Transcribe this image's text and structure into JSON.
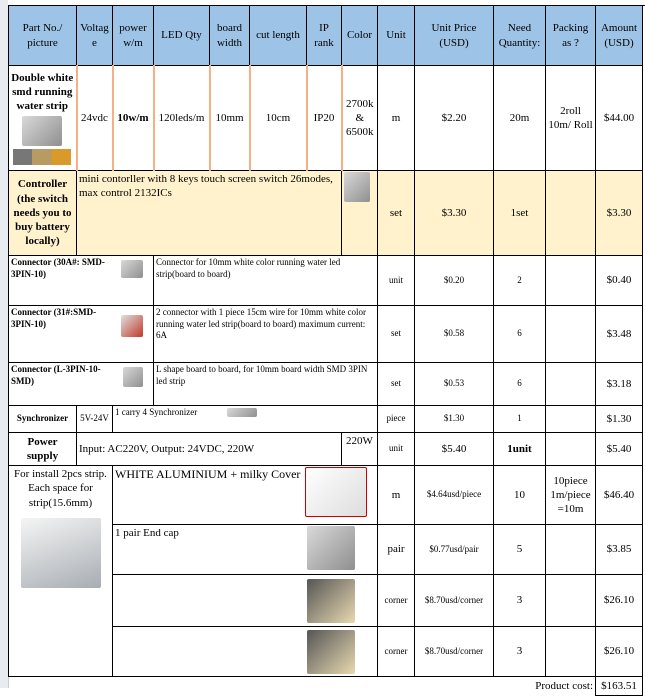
{
  "header": [
    "Part No./ picture",
    "Voltag e",
    "power w/m",
    "LED Qty",
    "board width",
    "cut length",
    "IP rank",
    "Color",
    "Unit",
    "Unit Price (USD)",
    "Need Quantity:",
    "Packing as ?",
    "Amount (USD)"
  ],
  "strip": {
    "name": "Double white smd running water strip",
    "voltage": "24vdc",
    "power": "10w/m",
    "led_qty": "120leds/m",
    "board_width": "10mm",
    "cut_length": "10cm",
    "ip": "IP20",
    "color": "2700k & 6500k",
    "unit": "m",
    "price": "$2.20",
    "qty": "20m",
    "packing": "2roll 10m/ Roll",
    "amount": "$44.00"
  },
  "controller": {
    "name": "Controller (the switch needs you to buy battery locally)",
    "desc": "mini contorller with 8 keys touch screen switch 26modes, max control 2132ICs",
    "unit": "set",
    "price": "$3.30",
    "qty": "1set",
    "amount": "$3.30"
  },
  "connectors": [
    {
      "name": "Connector (30A#: SMD-3PIN-10)",
      "desc": "Connector for 10mm white color running water led strip(board to board)",
      "unit": "unit",
      "price": "$0.20",
      "qty": "2",
      "amount": "$0.40"
    },
    {
      "name": "Connector (31#:SMD-3PIN-10)",
      "desc": "2 connector with 1 piece 15cm wire for 10mm white color running water led strip(board to board) maximum current: 6A",
      "unit": "set",
      "price": "$0.58",
      "qty": "6",
      "amount": "$3.48"
    },
    {
      "name": "Connector (L-3PIN-10-SMD)",
      "desc": "L shape board to board, for 10mm board width SMD 3PIN led strip",
      "unit": "set",
      "price": "$0.53",
      "qty": "6",
      "amount": "$3.18"
    }
  ],
  "sync": {
    "name": "Synchronizer",
    "voltage": "5V-24V",
    "desc": "1 carry 4 Synchronizer",
    "unit": "piece",
    "price": "$1.30",
    "qty": "1",
    "amount": "$1.30"
  },
  "power": {
    "name": "Power supply",
    "desc": "Input: AC220V, Output: 24VDC, 220W",
    "watt": "220W",
    "unit": "unit",
    "price": "$5.40",
    "qty": "1unit",
    "amount": "$5.40"
  },
  "alu": {
    "name": "For install 2pcs strip. Each space for strip(15.6mm)",
    "desc": "WHITE ALUMINIUM + milky Cover",
    "unit": "m",
    "price": "$4.64usd/piece",
    "qty": "10",
    "packing": "10piece 1m/piece =10m",
    "amount": "$46.40"
  },
  "endcap": {
    "desc": "1 pair End cap",
    "unit": "pair",
    "price": "$0.77usd/pair",
    "qty": "5",
    "amount": "$3.85"
  },
  "corners": [
    {
      "unit": "corner",
      "price": "$8.70usd/corner",
      "qty": "3",
      "amount": "$26.10"
    },
    {
      "unit": "corner",
      "price": "$8.70usd/corner",
      "qty": "3",
      "amount": "$26.10"
    }
  ],
  "total": {
    "label": "Product cost:",
    "value": "$163.51"
  }
}
